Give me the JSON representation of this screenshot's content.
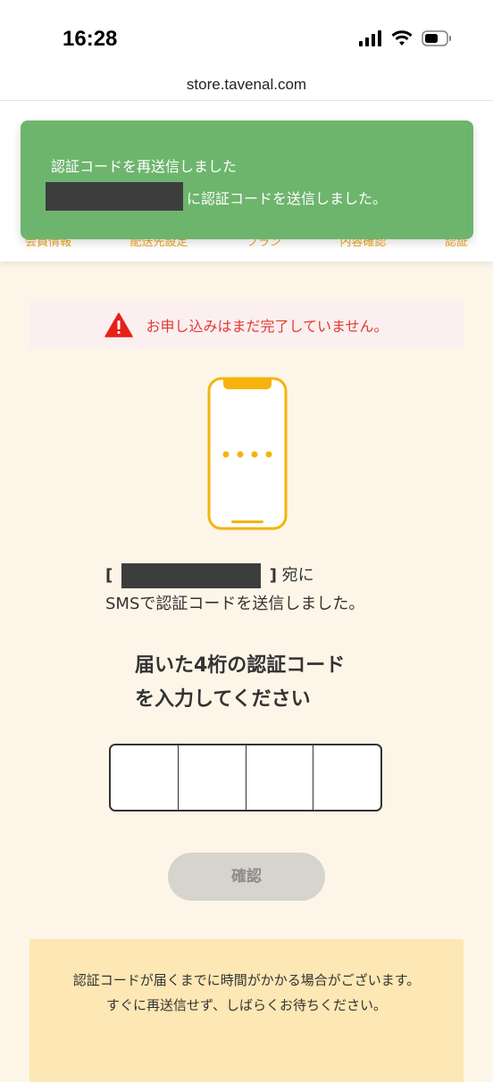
{
  "status_bar": {
    "time": "16:28"
  },
  "browser": {
    "url": "store.tavenal.com"
  },
  "steps": [
    "会員情報",
    "配送先設定",
    "プラン",
    "内容確認",
    "認証"
  ],
  "toast": {
    "line1": "認証コードを再送信しました",
    "line2": "に認証コードを送信しました。"
  },
  "warning": {
    "text": "お申し込みはまだ完了していません。"
  },
  "recipient": {
    "open": "[",
    "close": "]",
    "suffix": "宛に"
  },
  "sms_text": "SMSで認証コードを送信しました。",
  "instruction": {
    "line1": "届いた4桁の認証コード",
    "line2": "を入力してください"
  },
  "confirm_label": "確認",
  "note": {
    "line1": "認証コードが届くまでに時間がかかる場合がございます。",
    "line2": "すぐに再送信せず、しばらくお待ちください。"
  },
  "colors": {
    "accent": "#f5b30b",
    "toast": "#6db56d",
    "warning": "#e03b2f",
    "background": "#fdf6e8"
  }
}
